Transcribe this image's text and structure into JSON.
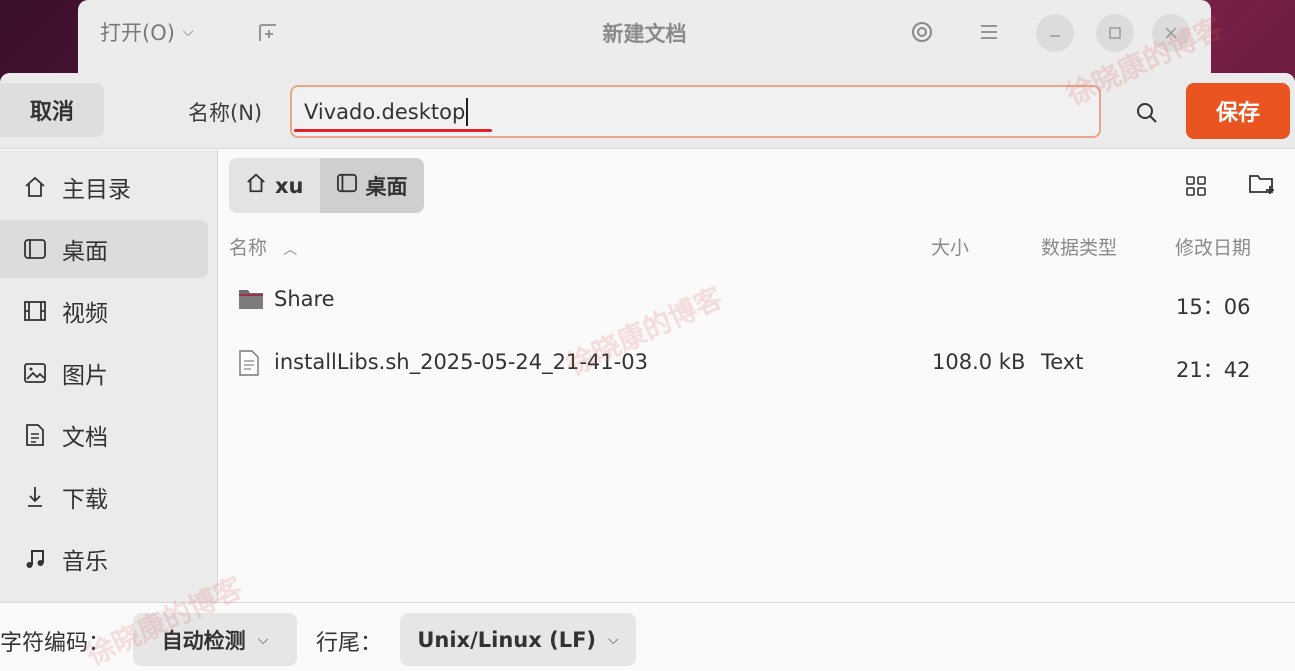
{
  "editor": {
    "open_label": "打开(O)",
    "title": "新建文档"
  },
  "dialog": {
    "cancel_label": "取消",
    "name_label": "名称(N)",
    "filename_value": "Vivado.desktop",
    "save_label": "保存"
  },
  "sidebar": {
    "items": [
      {
        "label": "主目录",
        "icon": "home-icon"
      },
      {
        "label": "桌面",
        "icon": "desktop-icon",
        "active": true
      },
      {
        "label": "视频",
        "icon": "video-icon"
      },
      {
        "label": "图片",
        "icon": "picture-icon"
      },
      {
        "label": "文档",
        "icon": "document-icon"
      },
      {
        "label": "下载",
        "icon": "download-icon"
      },
      {
        "label": "音乐",
        "icon": "music-icon"
      }
    ]
  },
  "breadcrumb": {
    "items": [
      {
        "label": "xu",
        "icon": "home-icon"
      },
      {
        "label": "桌面",
        "icon": "desktop-icon"
      }
    ]
  },
  "columns": {
    "name": "名称",
    "size": "大小",
    "type": "数据类型",
    "modified": "修改日期"
  },
  "files": [
    {
      "name": "Share",
      "size": "",
      "type": "",
      "modified": "15：06",
      "icon": "folder-icon"
    },
    {
      "name": "installLibs.sh_2025-05-24_21-41-03",
      "size": "108.0 kB",
      "type": "Text",
      "modified": "21：42",
      "icon": "text-file-icon"
    }
  ],
  "footer": {
    "encoding_label": "字符编码：",
    "encoding_value": "自动检测",
    "eol_label": "行尾：",
    "eol_value": "Unix/Linux (LF)"
  },
  "watermark": "徐晓康的博客",
  "colors": {
    "accent": "#e95420",
    "underline": "#e0202a"
  }
}
